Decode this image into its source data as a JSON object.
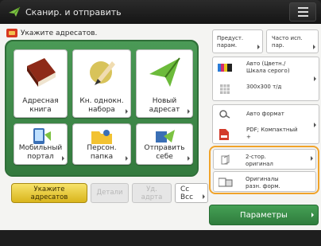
{
  "header": {
    "title": "Сканир. и отправить",
    "menu_icon": "menu-icon"
  },
  "status": {
    "text": "Укажите адресатов."
  },
  "tiles": [
    {
      "label": "Адресная\nкнига",
      "icon": "address-book-icon"
    },
    {
      "label": "Кн. однокн.\nнабора",
      "icon": "one-touch-icon"
    },
    {
      "label": "Новый\nадресат",
      "icon": "new-destination-icon"
    },
    {
      "label": "Мобильный\nпортал",
      "icon": "mobile-portal-icon"
    },
    {
      "label": "Персон.\nпапка",
      "icon": "personal-folder-icon"
    },
    {
      "label": "Отправить\nсебе",
      "icon": "send-to-myself-icon"
    }
  ],
  "bottom_buttons": {
    "specify": "Укажите\nадресатов",
    "details": "Детали",
    "delete": "Уд.\nадрта",
    "cc": "Cc\nBcc"
  },
  "settings": {
    "resolution_preset": "Предуст.\nпарам.",
    "freq_used": "Часто исп.\nпар.",
    "color_mode": "Авто (Цветн./\nШкала серого)",
    "resolution": "300x300 т/д",
    "file_format": "Авто формат",
    "pdf_format": "PDF; Компактный\n+",
    "duplex": "2-стор.\nоригинал",
    "orig_size": "Оригиналы\nразн. форм."
  },
  "params_button": "Параметры",
  "colors": {
    "accent_green": "#3f8a49",
    "highlight_orange": "#f0a32a",
    "yellow": "#e8c936"
  }
}
